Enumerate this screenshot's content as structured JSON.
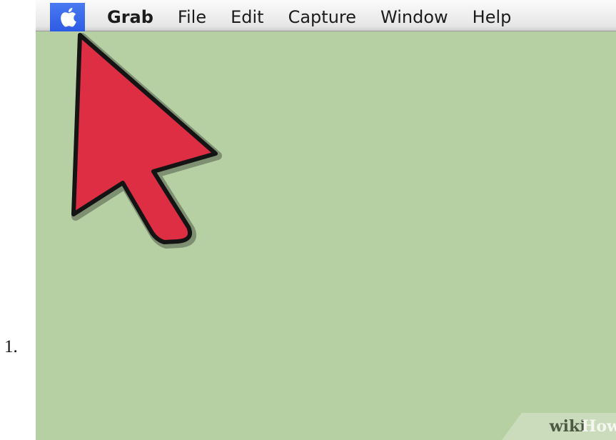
{
  "list_marker": "1.",
  "menubar": {
    "apple_icon": "apple-logo-icon",
    "app_name": "Grab",
    "items": [
      "File",
      "Edit",
      "Capture",
      "Window",
      "Help"
    ]
  },
  "annotation": {
    "icon": "arrow-pointer-icon",
    "color": "#dd2e44"
  },
  "watermark": {
    "part1": "wiki",
    "part2": "How"
  },
  "colors": {
    "desktop": "#b6cfa3",
    "apple_highlight": "#3a68ec"
  }
}
